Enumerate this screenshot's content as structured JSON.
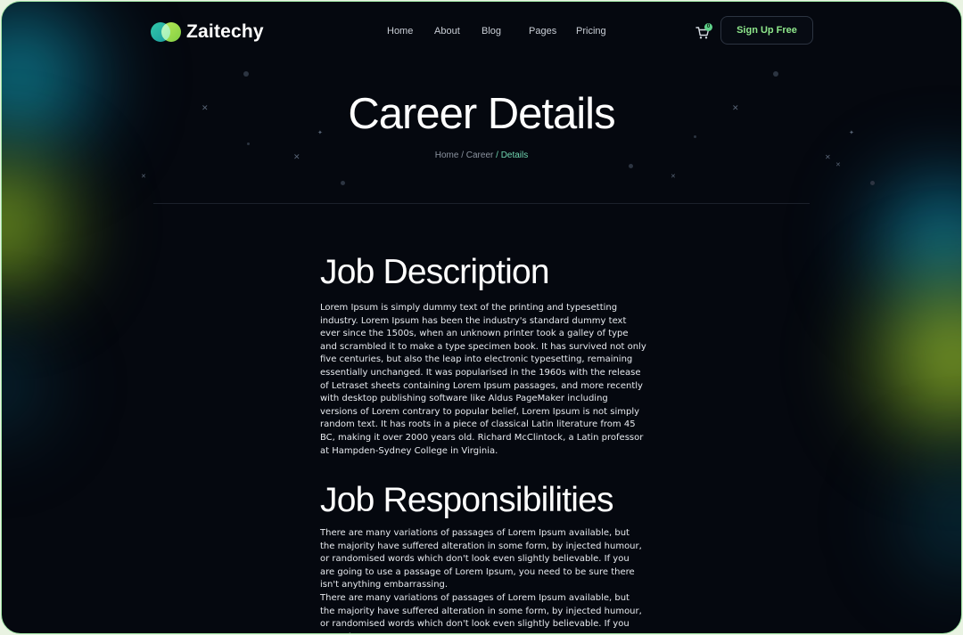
{
  "brand": {
    "name": "Zaitechy"
  },
  "nav": {
    "items": [
      "Home",
      "About",
      "Blog",
      "Pages",
      "Pricing"
    ]
  },
  "cart": {
    "count": "0"
  },
  "signup": {
    "label": "Sign Up Free"
  },
  "hero": {
    "title": "Career Details",
    "breadcrumb": {
      "home": "Home",
      "sep1": " / ",
      "career": "Career",
      "sep2": " / ",
      "current": "Details"
    }
  },
  "sections": {
    "description": {
      "heading": "Job Description",
      "body": "Lorem Ipsum is simply dummy text of the printing and typesetting industry. Lorem Ipsum has been the industry's standard dummy text ever since the 1500s, when an unknown printer took a galley of type and scrambled it to make a type specimen book. It has survived not only five centuries, but also the leap into electronic typesetting, remaining essentially unchanged. It was popularised in the 1960s with the release of Letraset sheets containing Lorem Ipsum passages, and more recently with desktop publishing software like Aldus PageMaker including versions of Lorem contrary to popular belief, Lorem Ipsum is not simply random text. It has roots in a piece of classical Latin literature from 45 BC, making it over 2000 years old. Richard McClintock, a Latin professor at Hampden-Sydney College in Virginia."
    },
    "responsibilities": {
      "heading": "Job Responsibilities",
      "body1": "There are many variations of passages of Lorem Ipsum available, but the majority have suffered alteration in some form, by injected humour, or randomised words which don't look even slightly believable. If you are going to use a passage of Lorem Ipsum, you need to be sure there isn't anything embarrassing.",
      "body2": "There are many variations of passages of Lorem Ipsum available, but the majority have suffered alteration in some form, by injected humour, or randomised words which don't look even slightly believable. If you are going to"
    }
  },
  "colors": {
    "accent": "#8fe88c",
    "breadcrumb_active": "#6fd5b0",
    "background": "#05080f"
  }
}
